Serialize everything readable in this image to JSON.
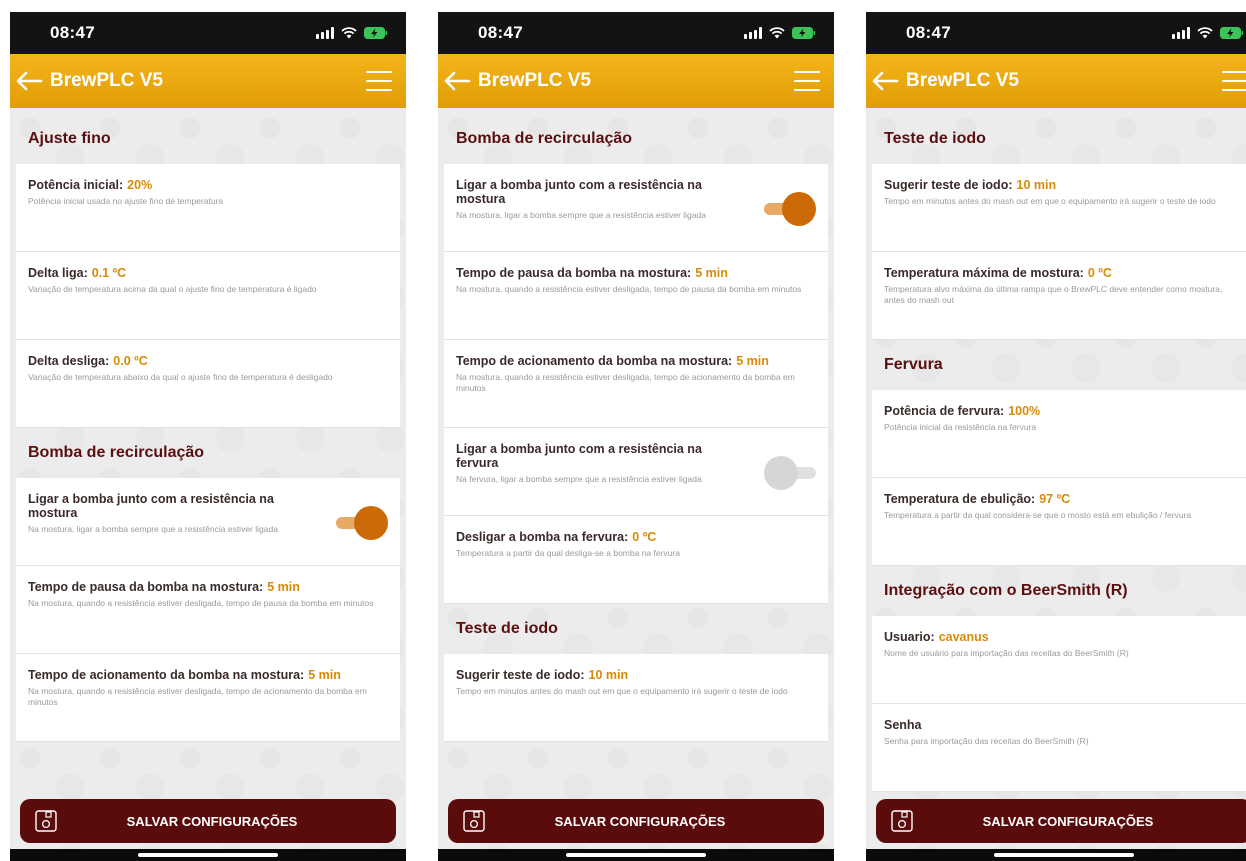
{
  "status_bar": {
    "time": "08:47"
  },
  "header": {
    "title": "BrewPLC V5"
  },
  "save_button": {
    "label": "SALVAR CONFIGURAÇÕES"
  },
  "screens": [
    {
      "rows": [
        {
          "kind": "section",
          "title": "Ajuste fino"
        },
        {
          "kind": "setting",
          "label": "Potência inicial:",
          "value": "20%",
          "description": "Potência inicial usada no ajuste fino de temperatura"
        },
        {
          "kind": "setting",
          "label": "Delta liga:",
          "value": "0.1 ºC",
          "description": "Variação de temperatura acima da qual o ajuste fino de temperatura é ligado"
        },
        {
          "kind": "setting",
          "label": "Delta desliga:",
          "value": "0.0 ºC",
          "description": "Variação de temperatura abaixo da qual o ajuste fino de temperatura é desligado"
        },
        {
          "kind": "section",
          "title": "Bomba de recirculação"
        },
        {
          "kind": "toggle",
          "label": "Ligar a bomba junto com a resistência na mostura",
          "description": "Na mostura, ligar a bomba sempre que a resistência estiver ligada",
          "state": "on"
        },
        {
          "kind": "setting",
          "label": "Tempo de pausa da bomba na mostura:",
          "value": "5 min",
          "description": "Na mostura, quando a resistência estiver desligada, tempo de pausa da bomba em minutos"
        },
        {
          "kind": "setting",
          "label": "Tempo de acionamento da bomba na mostura:",
          "value": "5 min",
          "description": "Na mostura, quando a resistência estiver desligada, tempo de acionamento da bomba em minutos"
        }
      ]
    },
    {
      "rows": [
        {
          "kind": "section",
          "title": "Bomba de recirculação"
        },
        {
          "kind": "toggle",
          "label": "Ligar a bomba junto com a resistência na mostura",
          "description": "Na mostura, ligar a bomba sempre que a resistência estiver ligada",
          "state": "on"
        },
        {
          "kind": "setting",
          "label": "Tempo de pausa da bomba na mostura:",
          "value": "5 min",
          "description": "Na mostura, quando a resistência estiver desligada, tempo de pausa da bomba em minutos"
        },
        {
          "kind": "setting",
          "label": "Tempo de acionamento da bomba na mostura:",
          "value": "5 min",
          "description": "Na mostura, quando a resistência estiver desligada, tempo de acionamento da bomba em minutos"
        },
        {
          "kind": "toggle",
          "label": "Ligar a bomba junto com a resistência na fervura",
          "description": "Na fervura, ligar a bomba sempre que a resistência estiver ligada",
          "state": "off"
        },
        {
          "kind": "setting",
          "label": "Desligar a bomba na fervura:",
          "value": "0 ºC",
          "description": "Temperatura a partir da qual desliga-se a bomba na fervura"
        },
        {
          "kind": "section",
          "title": "Teste de iodo"
        },
        {
          "kind": "setting",
          "label": "Sugerir teste de iodo:",
          "value": "10 min",
          "description": "Tempo em minutos antes do mash out em que o equipamento irá sugerir o teste de iodo"
        }
      ]
    },
    {
      "rows": [
        {
          "kind": "section",
          "title": "Teste de iodo"
        },
        {
          "kind": "setting",
          "label": "Sugerir teste de iodo:",
          "value": "10 min",
          "description": "Tempo em minutos antes do mash out em que o equipamento irá sugerir o teste de iodo"
        },
        {
          "kind": "setting",
          "label": "Temperatura máxima de mostura:",
          "value": "0 ºC",
          "description": "Temperatura alvo máxima da última rampa que o BrewPLC deve entender como mostura, antes do mash out"
        },
        {
          "kind": "section",
          "title": "Fervura"
        },
        {
          "kind": "setting",
          "label": "Potência de fervura:",
          "value": "100%",
          "description": "Potência inicial da resistência na fervura"
        },
        {
          "kind": "setting",
          "label": "Temperatura de ebulição:",
          "value": "97 ºC",
          "description": "Temperatura a partir da qual considera-se que o mosto está em ebulição / fervura"
        },
        {
          "kind": "section",
          "title": "Integração com o BeerSmith (R)"
        },
        {
          "kind": "setting",
          "label": "Usuario:",
          "value": "cavanus",
          "description": "Nome de usuário para importação das receitas do BeerSmith (R)"
        },
        {
          "kind": "setting",
          "label": "Senha",
          "value": "",
          "description": "Senha para importação das receitas do BeerSmith (R)"
        }
      ]
    }
  ],
  "colors": {
    "header": "#f0ac12",
    "section_text": "#5a1010",
    "value": "#d88a05",
    "toggle_on": "#cc6a08",
    "save_bar": "#5a0b0b"
  }
}
